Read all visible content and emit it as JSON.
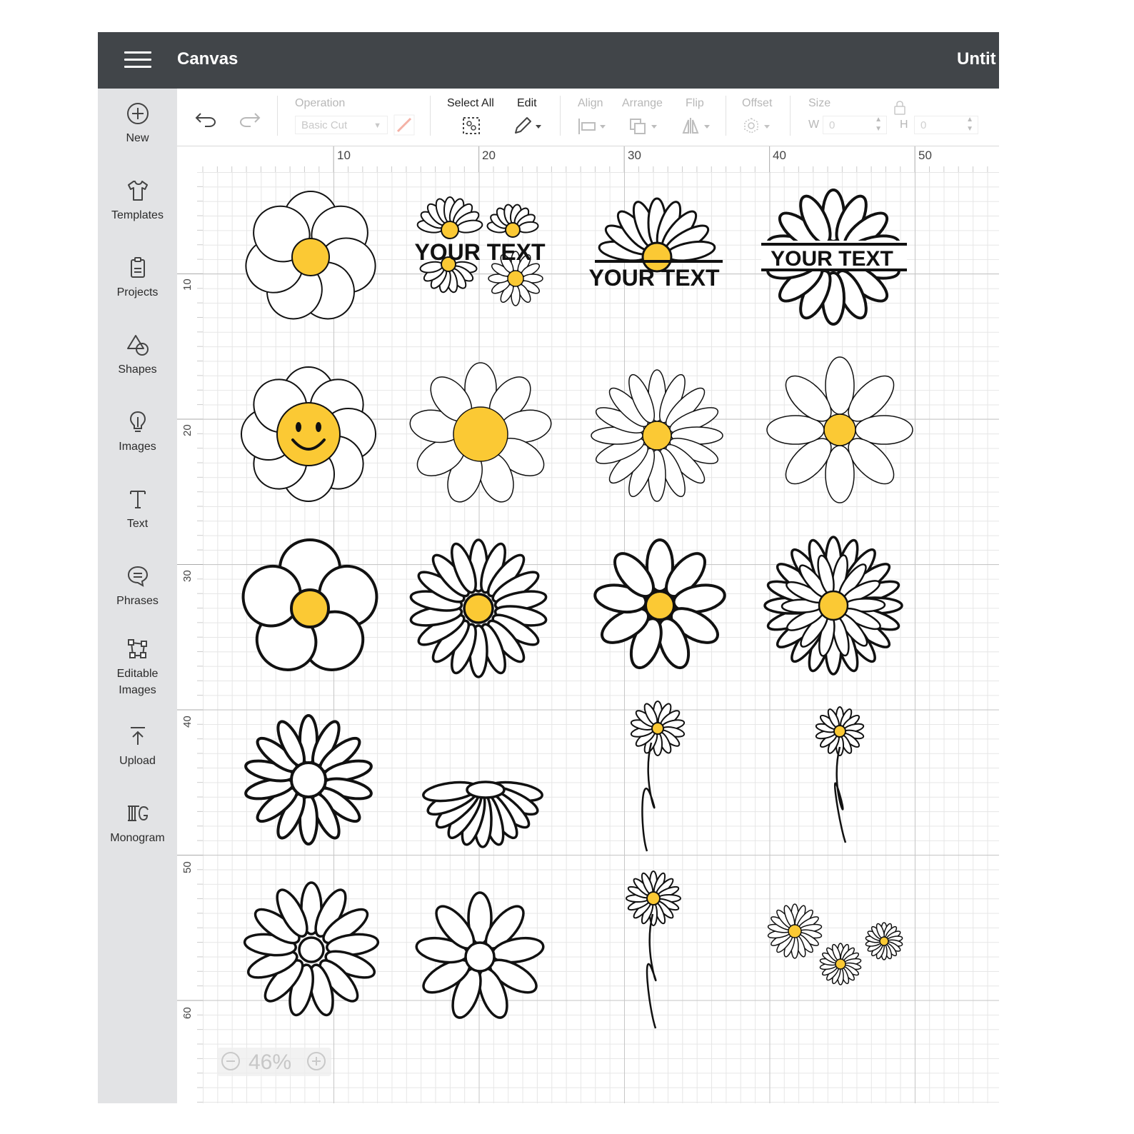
{
  "header": {
    "app_title": "Canvas",
    "doc_title": "Untit"
  },
  "sidebar": {
    "items": [
      {
        "label": "New",
        "icon": "plus-circle-icon"
      },
      {
        "label": "Templates",
        "icon": "shirt-icon"
      },
      {
        "label": "Projects",
        "icon": "clipboard-icon"
      },
      {
        "label": "Shapes",
        "icon": "shapes-icon"
      },
      {
        "label": "Images",
        "icon": "lightbulb-icon"
      },
      {
        "label": "Text",
        "icon": "text-t-icon"
      },
      {
        "label": "Phrases",
        "icon": "speech-bubble-icon"
      },
      {
        "label": "Editable",
        "label2": "Images",
        "icon": "editable-image-icon"
      },
      {
        "label": "Upload",
        "icon": "upload-icon"
      },
      {
        "label": "Monogram",
        "icon": "monogram-icon"
      }
    ]
  },
  "toolbar": {
    "operation_label": "Operation",
    "operation_value": "Basic Cut",
    "select_all_label": "Select All",
    "edit_label": "Edit",
    "align_label": "Align",
    "arrange_label": "Arrange",
    "flip_label": "Flip",
    "offset_label": "Offset",
    "size_label": "Size",
    "w_label": "W",
    "h_label": "H",
    "w_value": "0",
    "h_value": "0"
  },
  "rulers": {
    "top": [
      "10",
      "20",
      "30",
      "40",
      "50"
    ],
    "left": [
      "10",
      "20",
      "30",
      "40",
      "50",
      "60"
    ]
  },
  "designs": {
    "your_text": "YOUR TEXT"
  },
  "zoom": {
    "value": "46%"
  },
  "colors": {
    "header": "#414549",
    "sidebar": "#e2e3e5",
    "flower_center": "#fbc934",
    "grid_major": "#c7c7c7",
    "grid_minor": "#e6e6e6"
  }
}
